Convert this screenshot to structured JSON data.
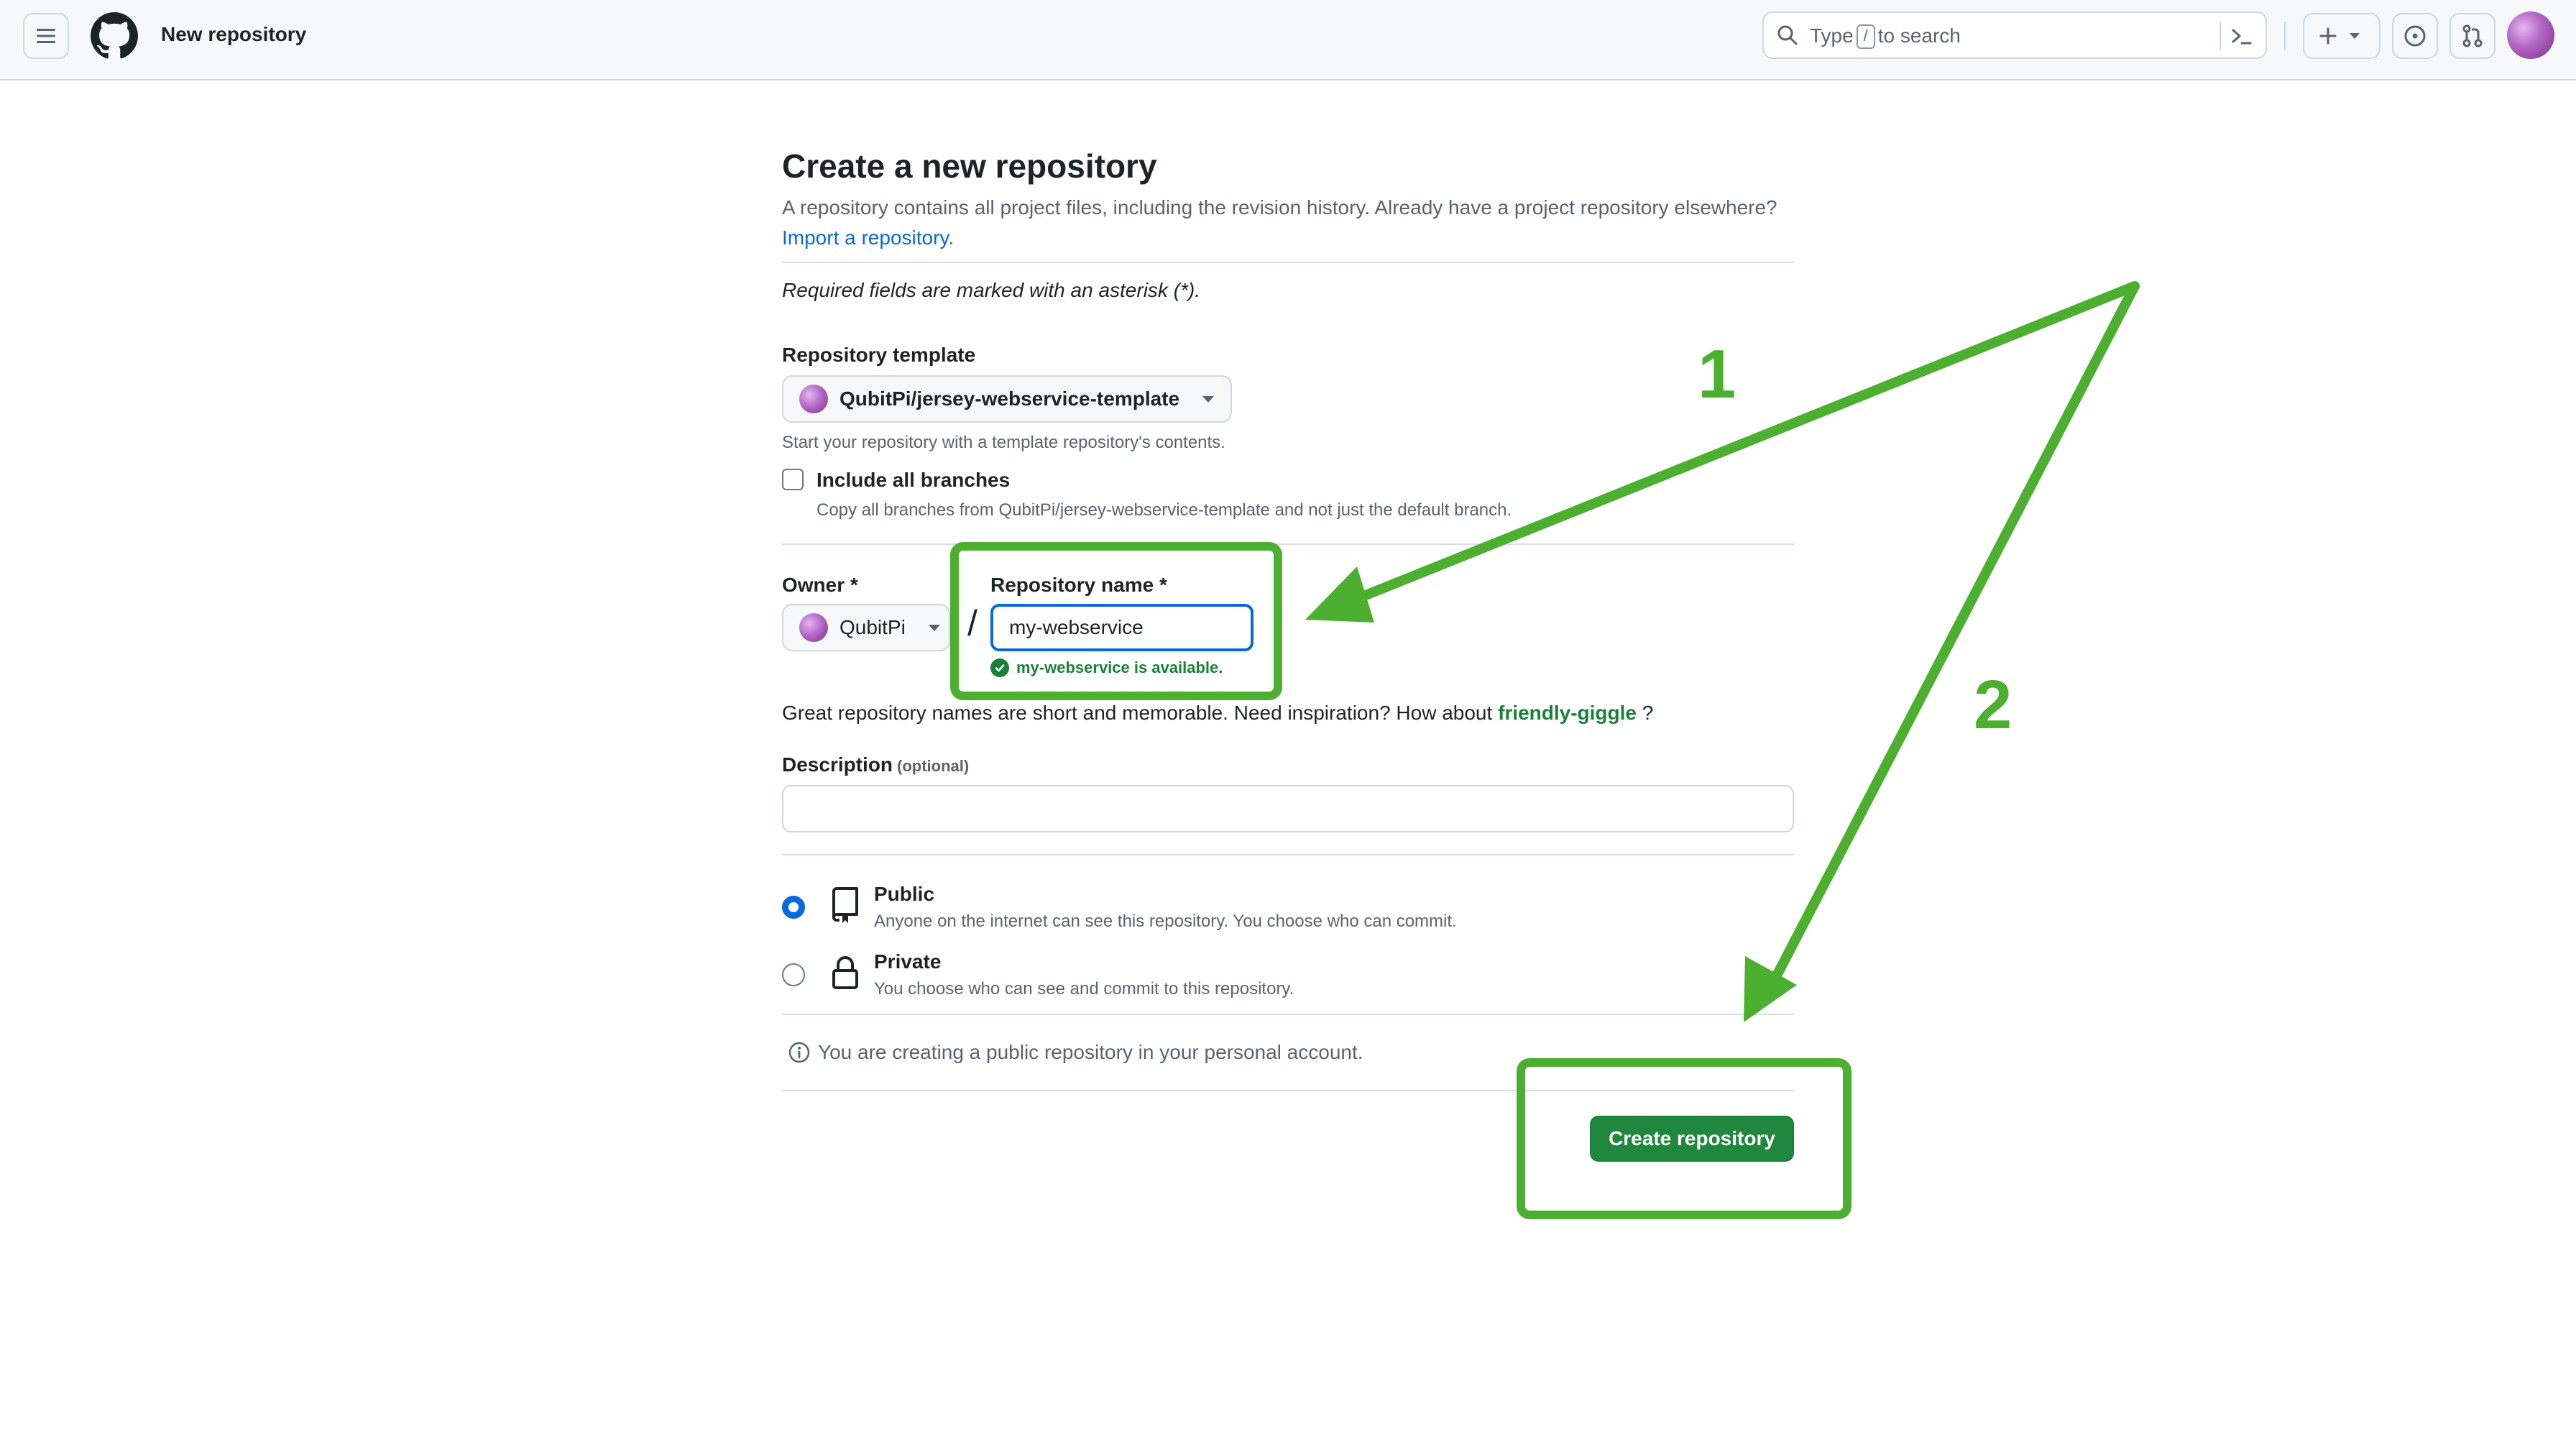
{
  "header": {
    "title": "New repository",
    "search": {
      "prefix": "Type",
      "key": "/",
      "suffix": "to search"
    }
  },
  "main": {
    "title": "Create a new repository",
    "intro": "A repository contains all project files, including the revision history. Already have a project repository elsewhere?",
    "import_link": "Import a repository.",
    "required_note": "Required fields are marked with an asterisk (*).",
    "template": {
      "label": "Repository template",
      "selected": "QubitPi/jersey-webservice-template",
      "hint": "Start your repository with a template repository's contents."
    },
    "include_branches": {
      "label": "Include all branches",
      "hint": "Copy all branches from QubitPi/jersey-webservice-template and not just the default branch.",
      "checked": false
    },
    "owner": {
      "label": "Owner *",
      "value": "QubitPi"
    },
    "separator": "/",
    "repo_name": {
      "label": "Repository name *",
      "value": "my-webservice",
      "status": "my-webservice is available."
    },
    "suggestion": {
      "text": "Great repository names are short and memorable. Need inspiration? How about",
      "name": "friendly-giggle",
      "end": "?"
    },
    "description": {
      "label": "Description",
      "optional": "(optional)",
      "value": ""
    },
    "visibility": {
      "public": {
        "label": "Public",
        "desc": "Anyone on the internet can see this repository. You choose who can commit.",
        "selected": true
      },
      "private": {
        "label": "Private",
        "desc": "You choose who can see and commit to this repository.",
        "selected": false
      }
    },
    "info": "You are creating a public repository in your personal account.",
    "create_button": "Create repository"
  },
  "annotations": {
    "step1": "1",
    "step2": "2",
    "color": "#4caf2f"
  },
  "colors": {
    "link": "#0969da",
    "success": "#1a7f37",
    "primary_button": "#1f883d"
  }
}
